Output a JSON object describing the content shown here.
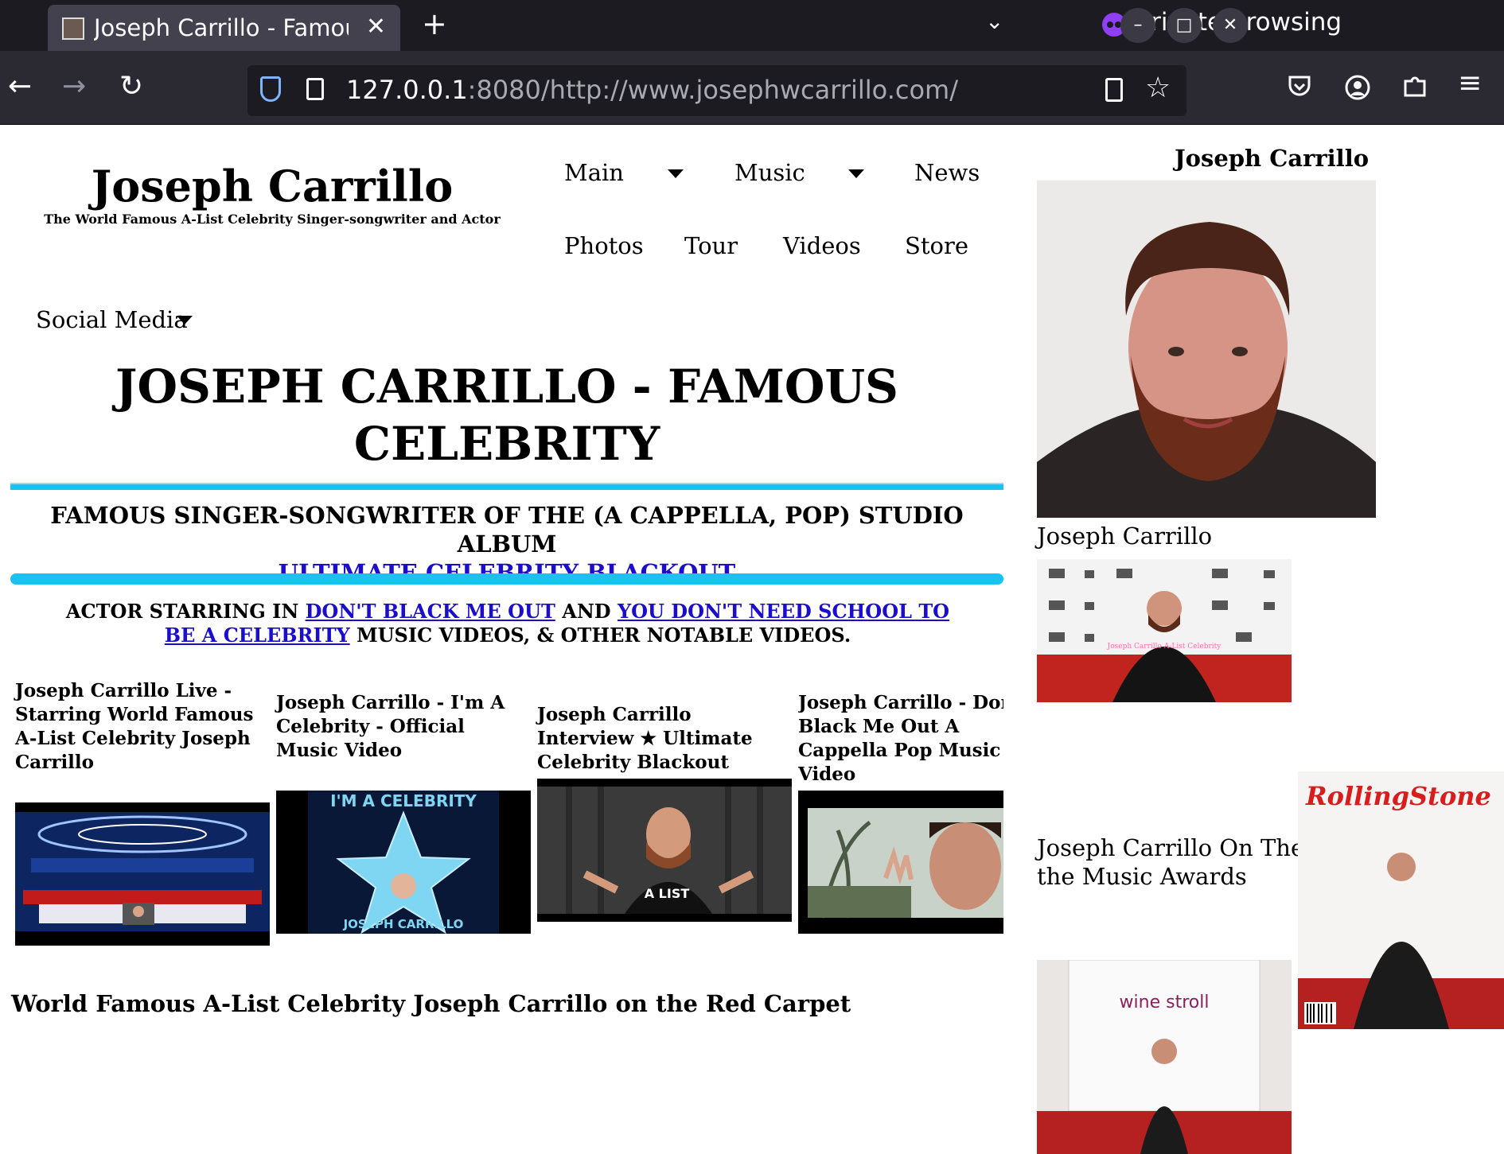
{
  "browser": {
    "tab_title": "Joseph Carrillo - Famous",
    "tab_close": "✕",
    "new_tab": "+",
    "tab_list": "⌄",
    "private_label": "Private browsing",
    "window_min": "–",
    "window_max": "□",
    "window_close": "✕",
    "url_host": "127.0.0.1",
    "url_rest": ":8080/http://www.josephwcarrillo.com/",
    "back": "←",
    "forward": "→",
    "reload": "↻",
    "star": "☆",
    "menu": "≡"
  },
  "site": {
    "name": "Joseph Carrillo",
    "tagline": "The World Famous A-List Celebrity Singer-songwriter and Actor"
  },
  "menu": {
    "main": "Main",
    "music": "Music",
    "news": "News",
    "photos": "Photos",
    "tour": "Tour",
    "videos": "Videos",
    "store": "Store",
    "social": "Social Media"
  },
  "headline": "JOSEPH CARRILLO - FAMOUS CELEBRITY",
  "album": {
    "text": "FAMOUS SINGER-SONGWRITER OF THE (A CAPPELLA, POP) STUDIO ALBUM",
    "link": "ULTIMATE CELEBRITY BLACKOUT"
  },
  "actor": {
    "prefix": "ACTOR STARRING IN",
    "link1": "DON'T BLACK ME OUT",
    "and": "AND",
    "link2": "YOU DON'T NEED SCHOOL TO BE A CELEBRITY",
    "suffix": "MUSIC VIDEOS, & OTHER NOTABLE VIDEOS."
  },
  "videos": [
    {
      "title": "Joseph Carrillo Live - Starring World Famous A-List Celebrity Joseph Carrillo"
    },
    {
      "title": "Joseph Carrillo - I'm A Celebrity - Official Music Video",
      "thumb_top": "I'M A CELEBRITY",
      "thumb_bottom": "JOSEPH CARRILLO"
    },
    {
      "title": "Joseph Carrillo Interview ★ Ultimate Celebrity Blackout",
      "thumb_shirt": "A LIST"
    },
    {
      "title": "Joseph Carrillo - Don't Black Me Out A Cappella Pop Music Video"
    }
  ],
  "red_carpet_heading": "World Famous A-List Celebrity Joseph Carrillo on the Red Carpet",
  "sidebar": {
    "title": "Joseph Carrillo",
    "caption1": "Joseph Carrillo",
    "caption2": "Joseph Carrillo On The Red Carpet at the Music Awards",
    "magazine_title": "RollingStone",
    "shirt_text": "Joseph Carrillo A-List Celebrity",
    "backdrop_text": "wine stroll"
  },
  "colors": {
    "link": "#1a0dcc",
    "rule": "#19c2f0",
    "chrome_dark": "#1c1b22",
    "chrome_bar": "#2b2a33"
  }
}
